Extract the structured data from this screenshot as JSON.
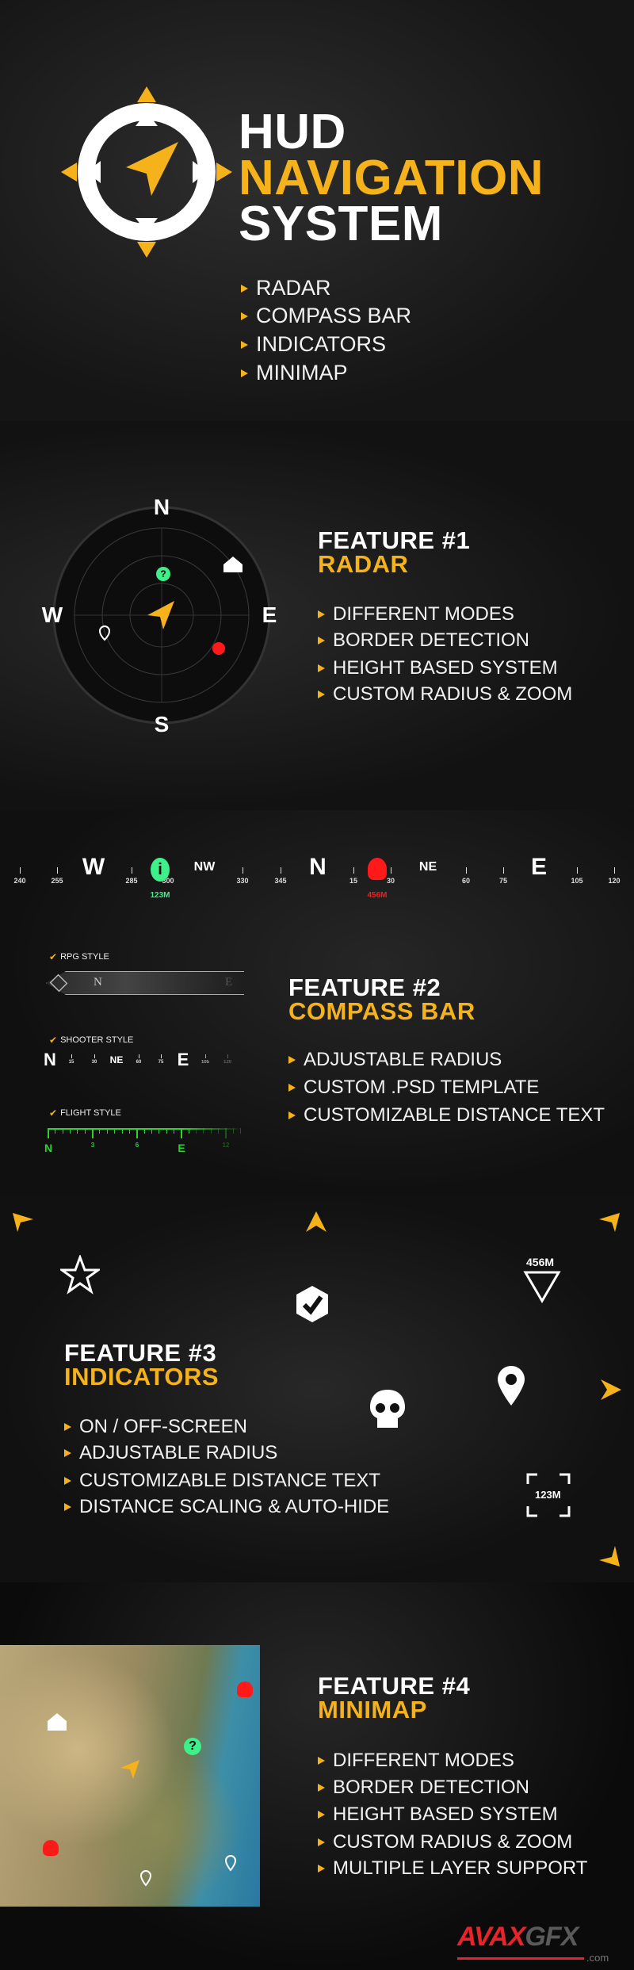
{
  "hero": {
    "title_line1": "HUD",
    "title_line2": "NAVIGATION",
    "title_line3": "SYSTEM",
    "features": [
      "RADAR",
      "COMPASS BAR",
      "INDICATORS",
      "MINIMAP"
    ]
  },
  "radar": {
    "heading": "FEATURE #1",
    "title": "RADAR",
    "directions": {
      "n": "N",
      "s": "S",
      "e": "E",
      "w": "W"
    },
    "bullets": [
      "DIFFERENT MODES",
      "BORDER DETECTION",
      "HEIGHT BASED SYSTEM",
      "CUSTOM RADIUS & ZOOM"
    ]
  },
  "compass": {
    "heading": "FEATURE #2",
    "title": "COMPASS BAR",
    "bar": {
      "numbers": [
        "240",
        "255",
        "285",
        "300",
        "330",
        "345",
        "15",
        "30",
        "60",
        "75",
        "105",
        "120"
      ],
      "letters": [
        "W",
        "NW",
        "N",
        "NE",
        "E"
      ],
      "marker_info_distance": "123M",
      "marker_enemy_distance": "456M"
    },
    "rpg": {
      "label": "RPG STYLE",
      "letters": [
        "N",
        "E"
      ]
    },
    "shooter": {
      "label": "SHOOTER STYLE",
      "letters": [
        "N",
        "NE",
        "E"
      ],
      "numbers": [
        "15",
        "30",
        "60",
        "75",
        "105",
        "120"
      ]
    },
    "flight": {
      "label": "FLIGHT STYLE",
      "marks": [
        "N",
        "3",
        "6",
        "E",
        "12"
      ]
    },
    "bullets": [
      "ADJUSTABLE RADIUS",
      "CUSTOM .PSD TEMPLATE",
      "CUSTOMIZABLE DISTANCE TEXT"
    ]
  },
  "indicators": {
    "heading": "FEATURE #3",
    "title": "INDICATORS",
    "triangle_distance": "456M",
    "bracket_distance": "123M",
    "bullets": [
      "ON / OFF-SCREEN",
      "ADJUSTABLE RADIUS",
      "CUSTOMIZABLE DISTANCE TEXT",
      "DISTANCE SCALING & AUTO-HIDE"
    ]
  },
  "minimap": {
    "heading": "FEATURE #4",
    "title": "MINIMAP",
    "bullets": [
      "DIFFERENT MODES",
      "BORDER DETECTION",
      "HEIGHT BASED SYSTEM",
      "CUSTOM RADIUS & ZOOM",
      "MULTIPLE LAYER SUPPORT"
    ]
  },
  "watermark": {
    "brand_red": "AVAX",
    "brand_gray": "GFX",
    "domain": ".com"
  },
  "colors": {
    "accent": "#f5b21b",
    "info_green": "#3df08a",
    "enemy_red": "#ff1a1a",
    "flight_green": "#2fd02f"
  }
}
